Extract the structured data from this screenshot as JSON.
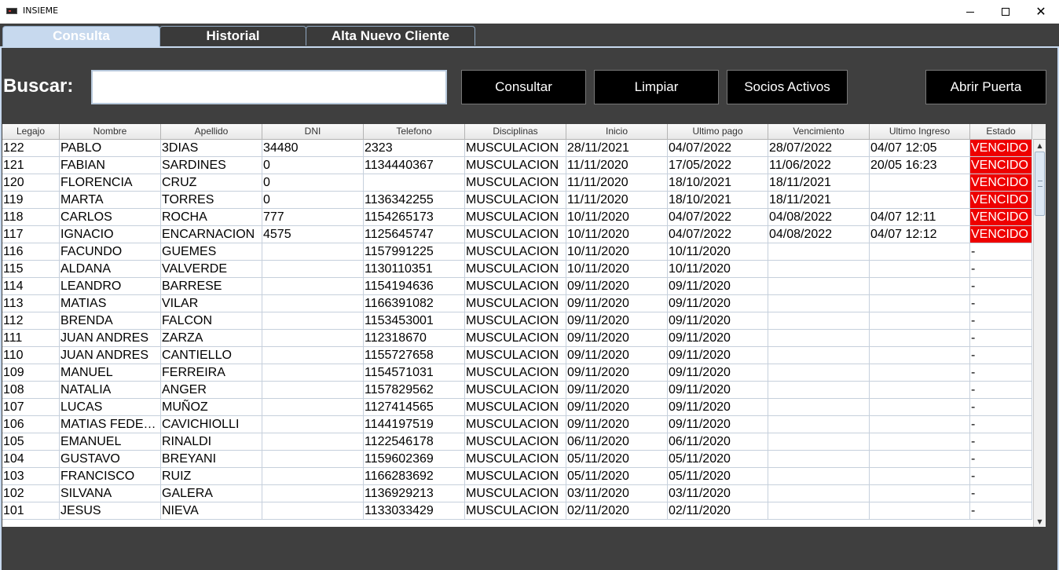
{
  "window": {
    "title": "INSIEME",
    "close_glyph": "✕"
  },
  "tabs": [
    {
      "label": "Consulta",
      "selected": true
    },
    {
      "label": "Historial",
      "selected": false
    },
    {
      "label": "Alta Nuevo Cliente",
      "selected": false
    }
  ],
  "search": {
    "label": "Buscar:",
    "value": ""
  },
  "buttons": {
    "consultar": "Consultar",
    "limpiar": "Limpiar",
    "socios_activos": "Socios Activos",
    "abrir_puerta": "Abrir Puerta"
  },
  "colors": {
    "vencido_bg": "#ee0000",
    "selected_tab": "#c7d9ee",
    "panel_bg": "#3f3f3f"
  },
  "scrollbar": {
    "up_glyph": "▲",
    "down_glyph": "▼"
  },
  "table": {
    "columns": [
      "Legajo",
      "Nombre",
      "Apellido",
      "DNI",
      "Telefono",
      "Disciplinas",
      "Inicio",
      "Ultimo pago",
      "Vencimiento",
      "Ultimo Ingreso",
      "Estado"
    ],
    "rows": [
      [
        "122",
        "PABLO",
        "3DIAS",
        "34480",
        "2323",
        "MUSCULACION",
        "28/11/2021",
        "04/07/2022",
        "28/07/2022",
        "04/07 12:05",
        "VENCIDO"
      ],
      [
        "121",
        "FABIAN",
        "SARDINES",
        "0",
        "1134440367",
        "MUSCULACION",
        "11/11/2020",
        "17/05/2022",
        "11/06/2022",
        "20/05 16:23",
        "VENCIDO"
      ],
      [
        "120",
        "FLORENCIA",
        "CRUZ",
        "0",
        "",
        "MUSCULACION",
        "11/11/2020",
        "18/10/2021",
        "18/11/2021",
        "",
        "VENCIDO"
      ],
      [
        "119",
        "MARTA",
        "TORRES",
        "0",
        "1136342255",
        "MUSCULACION",
        "11/11/2020",
        "18/10/2021",
        "18/11/2021",
        "",
        "VENCIDO"
      ],
      [
        "118",
        "CARLOS",
        "ROCHA",
        "777",
        "1154265173",
        "MUSCULACION",
        "10/11/2020",
        "04/07/2022",
        "04/08/2022",
        "04/07 12:11",
        "VENCIDO"
      ],
      [
        "117",
        "IGNACIO",
        "ENCARNACION",
        "4575",
        "1125645747",
        "MUSCULACION",
        "10/11/2020",
        "04/07/2022",
        "04/08/2022",
        "04/07 12:12",
        "VENCIDO"
      ],
      [
        "116",
        "FACUNDO",
        "GUEMES",
        "",
        "1157991225",
        "MUSCULACION",
        "10/11/2020",
        "10/11/2020",
        "",
        "",
        "-"
      ],
      [
        "115",
        "ALDANA",
        "VALVERDE",
        "",
        "1130110351",
        "MUSCULACION",
        "10/11/2020",
        "10/11/2020",
        "",
        "",
        "-"
      ],
      [
        "114",
        "LEANDRO",
        "BARRESE",
        "",
        "1154194636",
        "MUSCULACION",
        "09/11/2020",
        "09/11/2020",
        "",
        "",
        "-"
      ],
      [
        "113",
        "MATIAS",
        "VILAR",
        "",
        "1166391082",
        "MUSCULACION",
        "09/11/2020",
        "09/11/2020",
        "",
        "",
        "-"
      ],
      [
        "112",
        "BRENDA",
        "FALCON",
        "",
        "1153453001",
        "MUSCULACION",
        "09/11/2020",
        "09/11/2020",
        "",
        "",
        "-"
      ],
      [
        "111",
        "JUAN ANDRES",
        "ZARZA",
        "",
        "112318670",
        "MUSCULACION",
        "09/11/2020",
        "09/11/2020",
        "",
        "",
        "-"
      ],
      [
        "110",
        "JUAN ANDRES",
        "CANTIELLO",
        "",
        "1155727658",
        "MUSCULACION",
        "09/11/2020",
        "09/11/2020",
        "",
        "",
        "-"
      ],
      [
        "109",
        "MANUEL",
        "FERREIRA",
        "",
        "1154571031",
        "MUSCULACION",
        "09/11/2020",
        "09/11/2020",
        "",
        "",
        "-"
      ],
      [
        "108",
        "NATALIA",
        "ANGER",
        "",
        "1157829562",
        "MUSCULACION",
        "09/11/2020",
        "09/11/2020",
        "",
        "",
        "-"
      ],
      [
        "107",
        "LUCAS",
        "MUÑOZ",
        "",
        "1127414565",
        "MUSCULACION",
        "09/11/2020",
        "09/11/2020",
        "",
        "",
        "-"
      ],
      [
        "106",
        "MATIAS FEDER...",
        "CAVICHIOLLI",
        "",
        "1144197519",
        "MUSCULACION",
        "09/11/2020",
        "09/11/2020",
        "",
        "",
        "-"
      ],
      [
        "105",
        "EMANUEL",
        "RINALDI",
        "",
        "1122546178",
        "MUSCULACION",
        "06/11/2020",
        "06/11/2020",
        "",
        "",
        "-"
      ],
      [
        "104",
        "GUSTAVO",
        "BREYANI",
        "",
        "1159602369",
        "MUSCULACION",
        "05/11/2020",
        "05/11/2020",
        "",
        "",
        "-"
      ],
      [
        "103",
        "FRANCISCO",
        "RUIZ",
        "",
        "1166283692",
        "MUSCULACION",
        "05/11/2020",
        "05/11/2020",
        "",
        "",
        "-"
      ],
      [
        "102",
        "SILVANA",
        "GALERA",
        "",
        "1136929213",
        "MUSCULACION",
        "03/11/2020",
        "03/11/2020",
        "",
        "",
        "-"
      ],
      [
        "101",
        "JESUS",
        "NIEVA",
        "",
        "1133033429",
        "MUSCULACION",
        "02/11/2020",
        "02/11/2020",
        "",
        "",
        "-"
      ]
    ]
  }
}
